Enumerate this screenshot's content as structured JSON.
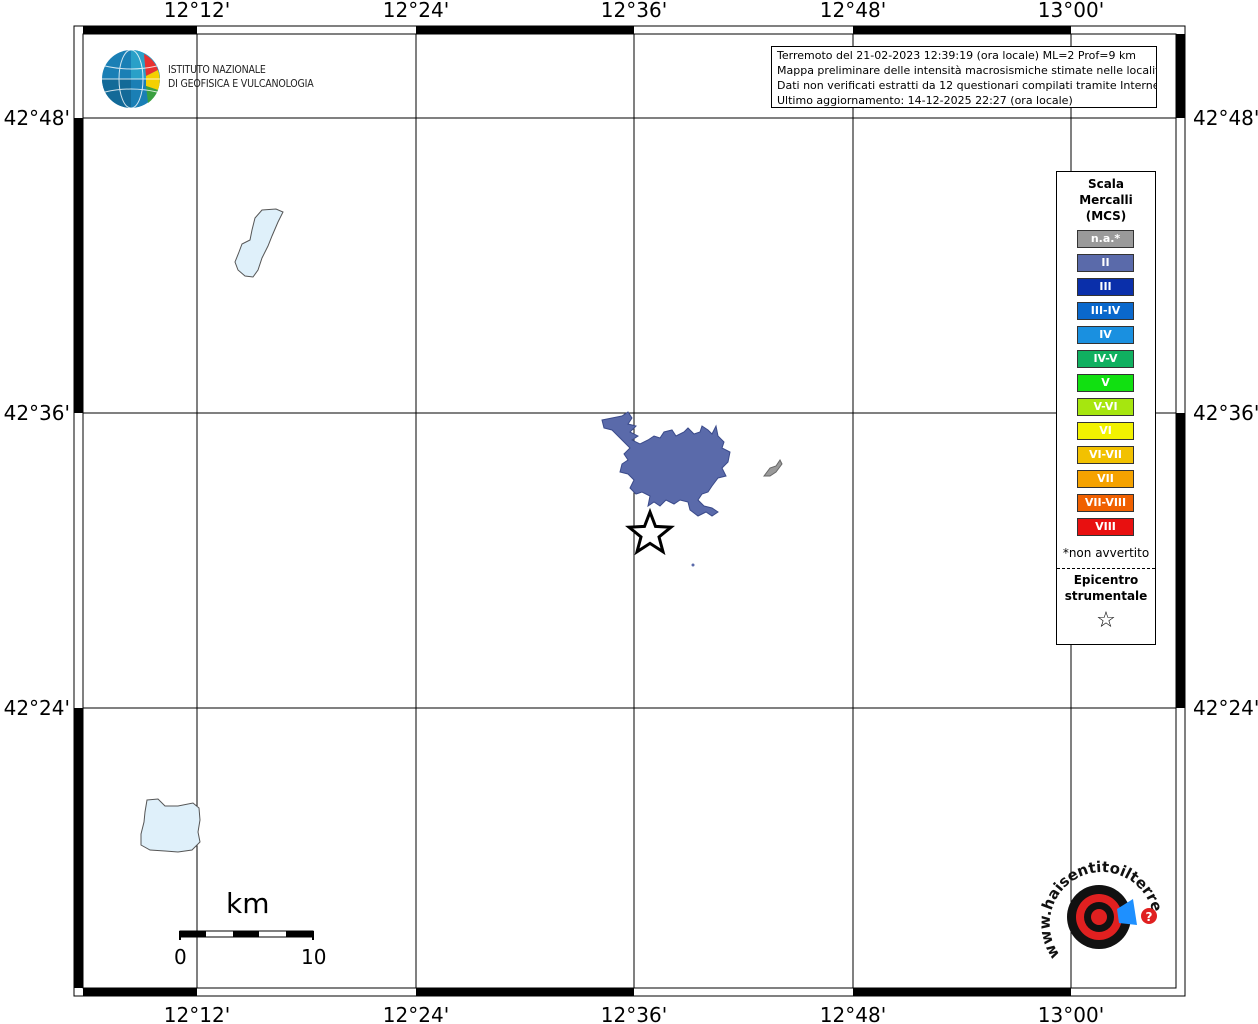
{
  "map": {
    "lon_labels": [
      "12°12'",
      "12°24'",
      "12°36'",
      "12°48'",
      "13°00'"
    ],
    "lat_labels": [
      "42°48'",
      "42°36'",
      "42°24'"
    ]
  },
  "info_box": {
    "lines": [
      "Terremoto del 21-02-2023 12:39:19 (ora locale) ML=2 Prof=9 km",
      "Mappa preliminare delle intensità macrosismiche stimate nelle località",
      "Dati non verificati estratti da 12 questionari compilati tramite Internet.",
      "Ultimo aggiornamento: 14-12-2025 22:27 (ora locale)"
    ]
  },
  "logo": {
    "line1": "ISTITUTO NAZIONALE",
    "line2": "DI GEOFISICA E VULCANOLOGIA"
  },
  "legend": {
    "title_lines": [
      "Scala",
      "Mercalli",
      "(MCS)"
    ],
    "items": [
      {
        "label": "n.a.*",
        "color": "#9a9a9a"
      },
      {
        "label": "II",
        "color": "#5a6aaa"
      },
      {
        "label": "III",
        "color": "#0a2faa"
      },
      {
        "label": "III-IV",
        "color": "#0a68cc"
      },
      {
        "label": "IV",
        "color": "#1a90e0"
      },
      {
        "label": "IV-V",
        "color": "#10b060"
      },
      {
        "label": "V",
        "color": "#11e011"
      },
      {
        "label": "V-VI",
        "color": "#a6e60f"
      },
      {
        "label": "VI",
        "color": "#f2f200"
      },
      {
        "label": "VI-VII",
        "color": "#f2c100"
      },
      {
        "label": "VII",
        "color": "#f5a200"
      },
      {
        "label": "VII-VIII",
        "color": "#f06000"
      },
      {
        "label": "VIII",
        "color": "#e81010"
      }
    ],
    "note": "*non avvertito",
    "epicenter_lines": [
      "Epicentro",
      "strumentale"
    ],
    "star_symbol": "☆"
  },
  "scale_bar": {
    "unit": "km",
    "min": "0",
    "max": "10"
  },
  "badge": {
    "text": "www.haisentitoilterremoto.it",
    "colors": {
      "red": "#e02020",
      "blue": "#1e90ff",
      "black": "#111111"
    }
  },
  "colors": {
    "intensity_ii": "#5a6aaa",
    "lake_fill": "#dff0fa",
    "na_fill": "#9a9a9a"
  }
}
